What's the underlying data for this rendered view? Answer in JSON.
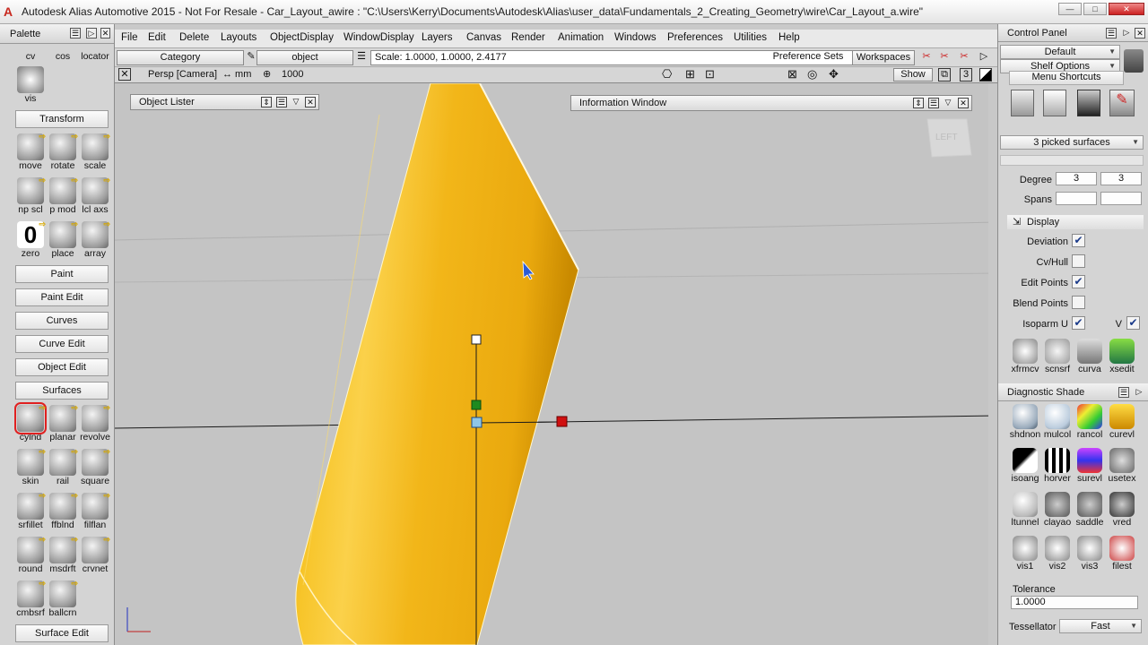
{
  "window": {
    "title": "Autodesk Alias Automotive 2015   - Not For Resale    - Car_Layout_awire : \"C:\\Users\\Kerry\\Documents\\Autodesk\\Alias\\user_data\\Fundamentals_2_Creating_Geometry\\wire\\Car_Layout_a.wire\"",
    "logo": "A",
    "controls": [
      "—",
      "□",
      "✕"
    ]
  },
  "palette": {
    "title": "Palette",
    "top_tools": [
      "cv",
      "cos",
      "locator",
      "vis"
    ],
    "sections": {
      "transform": "Transform",
      "paint": "Paint",
      "paint_edit": "Paint Edit",
      "curves": "Curves",
      "curve_edit": "Curve Edit",
      "object_edit": "Object Edit",
      "surfaces": "Surfaces",
      "surface_edit": "Surface Edit"
    },
    "transform_tools": [
      "move",
      "rotate",
      "scale",
      "np scl",
      "p mod",
      "lcl axs",
      "zero",
      "place",
      "array"
    ],
    "zero_glyph": "0",
    "surface_tools": [
      "cylnd",
      "planar",
      "revolve",
      "skin",
      "rail",
      "square",
      "srfillet",
      "ffblnd",
      "filflan",
      "round",
      "msdrft",
      "crvnet",
      "cmbsrf",
      "ballcrn"
    ]
  },
  "menubar": [
    "File",
    "Edit",
    "Delete",
    "Layouts",
    "ObjectDisplay",
    "WindowDisplay",
    "Layers",
    "Canvas",
    "Render",
    "Animation",
    "Windows",
    "Preferences",
    "Utilities",
    "Help"
  ],
  "toolbar": {
    "category": "Category",
    "object": "object",
    "scale": "Scale:  1.0000, 1.0000, 2.4177",
    "preference_sets": "Preference Sets",
    "workspaces": "Workspaces"
  },
  "viewhdr": {
    "camera": "Persp [Camera]",
    "units": "↔ mm",
    "grid": "1000",
    "show": "Show",
    "num": "3"
  },
  "viewport": {
    "object_lister": "Object Lister",
    "information_window": "Information Window",
    "viewcube_face": "LEFT"
  },
  "control_panel": {
    "title": "Control Panel",
    "default": "Default",
    "shelf_options": "Shelf Options",
    "menu_shortcuts": "Menu Shortcuts",
    "picked": "3 picked surfaces",
    "degree_label": "Degree",
    "degree_u": "3",
    "degree_v": "3",
    "spans_label": "Spans",
    "display_label": "Display",
    "deviation": "Deviation",
    "cvhull": "Cv/Hull",
    "edit_points": "Edit Points",
    "blend_points": "Blend Points",
    "isoparm_u": "Isoparm U",
    "isoparm_v": "V",
    "checks": {
      "deviation": "✔",
      "cvhull": "",
      "edit_points": "✔",
      "blend_points": "",
      "isoparm_u": "✔",
      "isoparm_v": "✔"
    },
    "shelf_tools": [
      "xfrmcv",
      "scnsrf",
      "curva",
      "xsedit"
    ],
    "diag_title": "Diagnostic Shade",
    "diag_tools": [
      "shdnon",
      "mulcol",
      "rancol",
      "curevl",
      "isoang",
      "horver",
      "surevl",
      "usetex",
      "ltunnel",
      "clayao",
      "saddle",
      "vred",
      "vis1",
      "vis2",
      "vis3",
      "filest"
    ],
    "tolerance_label": "Tolerance",
    "tolerance_value": "1.0000",
    "tessellator_label": "Tessellator",
    "tessellator_value": "Fast"
  },
  "colors": {
    "surface": "#f2b619",
    "surface_dark": "#c98a00",
    "viewport_bg": "#c4c4c4",
    "accent_red": "#d01010",
    "accent_green": "#1f8a1f"
  }
}
